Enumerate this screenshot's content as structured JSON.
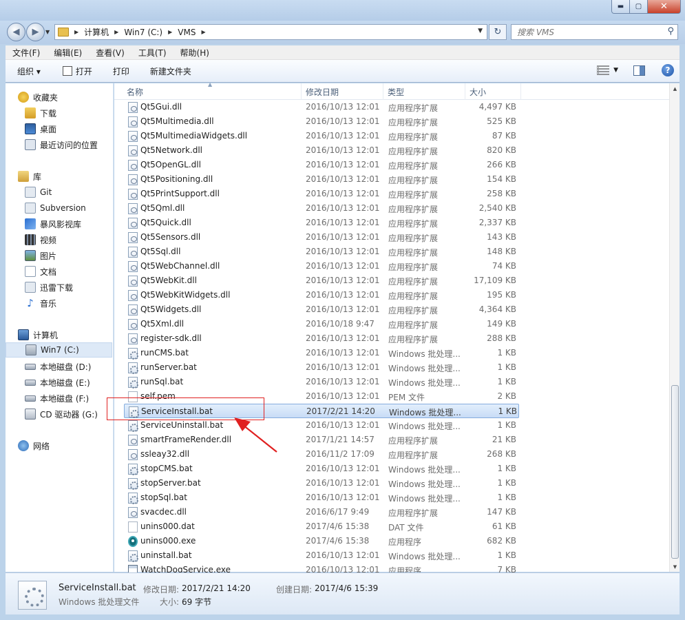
{
  "window": {
    "controls": {
      "minimize": "▬",
      "maximize": "▢",
      "close": "✕"
    }
  },
  "navigation": {
    "breadcrumbs": [
      "计算机",
      "Win7 (C:)",
      "VMS"
    ],
    "search_placeholder": "搜索 VMS"
  },
  "menu": [
    "文件(F)",
    "编辑(E)",
    "查看(V)",
    "工具(T)",
    "帮助(H)"
  ],
  "toolbar": {
    "organize": "组织 ▾",
    "open": "打开",
    "print": "打印",
    "new_folder": "新建文件夹"
  },
  "sidebar": {
    "favorites": [
      "收藏夹",
      "下载",
      "桌面",
      "最近访问的位置"
    ],
    "libraries": [
      "库",
      "Git",
      "Subversion",
      "暴风影视库",
      "视频",
      "图片",
      "文档",
      "迅雷下载",
      "音乐"
    ],
    "computer": [
      "计算机",
      "Win7 (C:)",
      "本地磁盘 (D:)",
      "本地磁盘 (E:)",
      "本地磁盘 (F:)",
      "CD 驱动器 (G:)"
    ],
    "network": [
      "网络"
    ]
  },
  "columns": {
    "name": "名称",
    "date": "修改日期",
    "type": "类型",
    "size": "大小"
  },
  "files": [
    {
      "name": "Qt5Gui.dll",
      "date": "2016/10/13 12:01",
      "type": "应用程序扩展",
      "size": "4,497 KB",
      "icon": "dll"
    },
    {
      "name": "Qt5Multimedia.dll",
      "date": "2016/10/13 12:01",
      "type": "应用程序扩展",
      "size": "525 KB",
      "icon": "dll"
    },
    {
      "name": "Qt5MultimediaWidgets.dll",
      "date": "2016/10/13 12:01",
      "type": "应用程序扩展",
      "size": "87 KB",
      "icon": "dll"
    },
    {
      "name": "Qt5Network.dll",
      "date": "2016/10/13 12:01",
      "type": "应用程序扩展",
      "size": "820 KB",
      "icon": "dll"
    },
    {
      "name": "Qt5OpenGL.dll",
      "date": "2016/10/13 12:01",
      "type": "应用程序扩展",
      "size": "266 KB",
      "icon": "dll"
    },
    {
      "name": "Qt5Positioning.dll",
      "date": "2016/10/13 12:01",
      "type": "应用程序扩展",
      "size": "154 KB",
      "icon": "dll"
    },
    {
      "name": "Qt5PrintSupport.dll",
      "date": "2016/10/13 12:01",
      "type": "应用程序扩展",
      "size": "258 KB",
      "icon": "dll"
    },
    {
      "name": "Qt5Qml.dll",
      "date": "2016/10/13 12:01",
      "type": "应用程序扩展",
      "size": "2,540 KB",
      "icon": "dll"
    },
    {
      "name": "Qt5Quick.dll",
      "date": "2016/10/13 12:01",
      "type": "应用程序扩展",
      "size": "2,337 KB",
      "icon": "dll"
    },
    {
      "name": "Qt5Sensors.dll",
      "date": "2016/10/13 12:01",
      "type": "应用程序扩展",
      "size": "143 KB",
      "icon": "dll"
    },
    {
      "name": "Qt5Sql.dll",
      "date": "2016/10/13 12:01",
      "type": "应用程序扩展",
      "size": "148 KB",
      "icon": "dll"
    },
    {
      "name": "Qt5WebChannel.dll",
      "date": "2016/10/13 12:01",
      "type": "应用程序扩展",
      "size": "74 KB",
      "icon": "dll"
    },
    {
      "name": "Qt5WebKit.dll",
      "date": "2016/10/13 12:01",
      "type": "应用程序扩展",
      "size": "17,109 KB",
      "icon": "dll"
    },
    {
      "name": "Qt5WebKitWidgets.dll",
      "date": "2016/10/13 12:01",
      "type": "应用程序扩展",
      "size": "195 KB",
      "icon": "dll"
    },
    {
      "name": "Qt5Widgets.dll",
      "date": "2016/10/13 12:01",
      "type": "应用程序扩展",
      "size": "4,364 KB",
      "icon": "dll"
    },
    {
      "name": "Qt5Xml.dll",
      "date": "2016/10/18 9:47",
      "type": "应用程序扩展",
      "size": "149 KB",
      "icon": "dll"
    },
    {
      "name": "register-sdk.dll",
      "date": "2016/10/13 12:01",
      "type": "应用程序扩展",
      "size": "288 KB",
      "icon": "dll"
    },
    {
      "name": "runCMS.bat",
      "date": "2016/10/13 12:01",
      "type": "Windows 批处理...",
      "size": "1 KB",
      "icon": "bat"
    },
    {
      "name": "runServer.bat",
      "date": "2016/10/13 12:01",
      "type": "Windows 批处理...",
      "size": "1 KB",
      "icon": "bat"
    },
    {
      "name": "runSql.bat",
      "date": "2016/10/13 12:01",
      "type": "Windows 批处理...",
      "size": "1 KB",
      "icon": "bat"
    },
    {
      "name": "self.pem",
      "date": "2016/10/13 12:01",
      "type": "PEM 文件",
      "size": "2 KB",
      "icon": "file"
    },
    {
      "name": "ServiceInstall.bat",
      "date": "2017/2/21 14:20",
      "type": "Windows 批处理...",
      "size": "1 KB",
      "icon": "bat",
      "selected": true
    },
    {
      "name": "ServiceUninstall.bat",
      "date": "2016/10/13 12:01",
      "type": "Windows 批处理...",
      "size": "1 KB",
      "icon": "bat"
    },
    {
      "name": "smartFrameRender.dll",
      "date": "2017/1/21 14:57",
      "type": "应用程序扩展",
      "size": "21 KB",
      "icon": "dll"
    },
    {
      "name": "ssleay32.dll",
      "date": "2016/11/2 17:09",
      "type": "应用程序扩展",
      "size": "268 KB",
      "icon": "dll"
    },
    {
      "name": "stopCMS.bat",
      "date": "2016/10/13 12:01",
      "type": "Windows 批处理...",
      "size": "1 KB",
      "icon": "bat"
    },
    {
      "name": "stopServer.bat",
      "date": "2016/10/13 12:01",
      "type": "Windows 批处理...",
      "size": "1 KB",
      "icon": "bat"
    },
    {
      "name": "stopSql.bat",
      "date": "2016/10/13 12:01",
      "type": "Windows 批处理...",
      "size": "1 KB",
      "icon": "bat"
    },
    {
      "name": "svacdec.dll",
      "date": "2016/6/17 9:49",
      "type": "应用程序扩展",
      "size": "147 KB",
      "icon": "dll"
    },
    {
      "name": "unins000.dat",
      "date": "2017/4/6 15:38",
      "type": "DAT 文件",
      "size": "61 KB",
      "icon": "file"
    },
    {
      "name": "unins000.exe",
      "date": "2017/4/6 15:38",
      "type": "应用程序",
      "size": "682 KB",
      "icon": "exe"
    },
    {
      "name": "uninstall.bat",
      "date": "2016/10/13 12:01",
      "type": "Windows 批处理...",
      "size": "1 KB",
      "icon": "bat"
    },
    {
      "name": "WatchDogService.exe",
      "date": "2016/10/13 12:01",
      "type": "应用程序",
      "size": "7 KB",
      "icon": "app"
    }
  ],
  "details": {
    "filename": "ServiceInstall.bat",
    "filetype": "Windows 批处理文件",
    "modified_label": "修改日期:",
    "modified_value": "2017/2/21 14:20",
    "created_label": "创建日期:",
    "created_value": "2017/4/6 15:39",
    "size_label": "大小:",
    "size_value": "69 字节"
  },
  "colors": {
    "annotation": "#e02020",
    "selection": "#cde0f7",
    "frame": "#bcd3ea"
  }
}
